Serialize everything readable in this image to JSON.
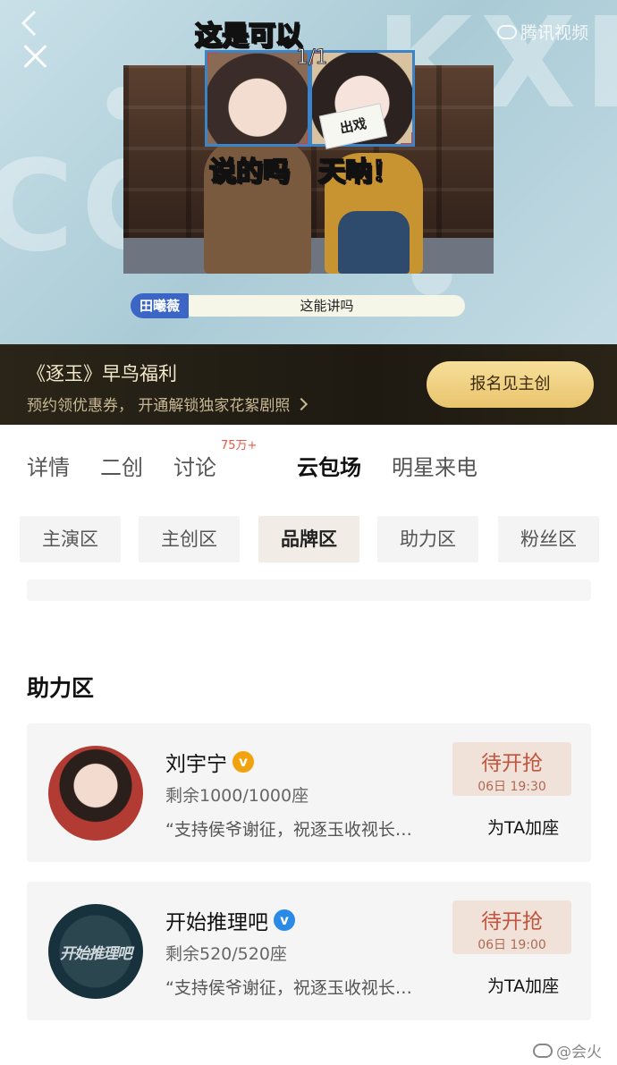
{
  "video": {
    "caption_top": "这是可以",
    "caption_left": "说的吗",
    "caption_right": "天呐！",
    "counter": "1/1",
    "watermark": "腾讯视频",
    "card_text": "出戏",
    "name_tag": "田曦薇",
    "name_text": "这能讲吗"
  },
  "promo": {
    "title": "《逐玉》早鸟福利",
    "subtitle": "预约领优惠券， 开通解锁独家花絮剧照",
    "button": "报名见主创"
  },
  "tabs": {
    "items": [
      "详情",
      "二创",
      "讨论",
      "云包场",
      "明星来电"
    ],
    "badge": "75万+",
    "active": "云包场"
  },
  "chips": {
    "items": [
      "主演区",
      "主创区",
      "品牌区",
      "助力区",
      "粉丝区"
    ],
    "active": "品牌区"
  },
  "section": {
    "title": "助力区"
  },
  "cards": [
    {
      "name": "刘宇宁",
      "verify_color": "#f2a20e",
      "seats": "剩余1000/1000座",
      "message": "“支持侯爷谢征，祝逐玉收视长…",
      "grab_label": "待开抢",
      "grab_time": "06日 19:30",
      "action": "为TA加座"
    },
    {
      "name": "开始推理吧",
      "avatar_text": "开始推理吧",
      "verify_color": "#2a8be6",
      "seats": "剩余520/520座",
      "message": "“支持侯爷谢征，祝逐玉收视长…",
      "grab_label": "待开抢",
      "grab_time": "06日 19:00",
      "action": "为TA加座"
    }
  ],
  "footer": {
    "watermark": "@会火"
  }
}
